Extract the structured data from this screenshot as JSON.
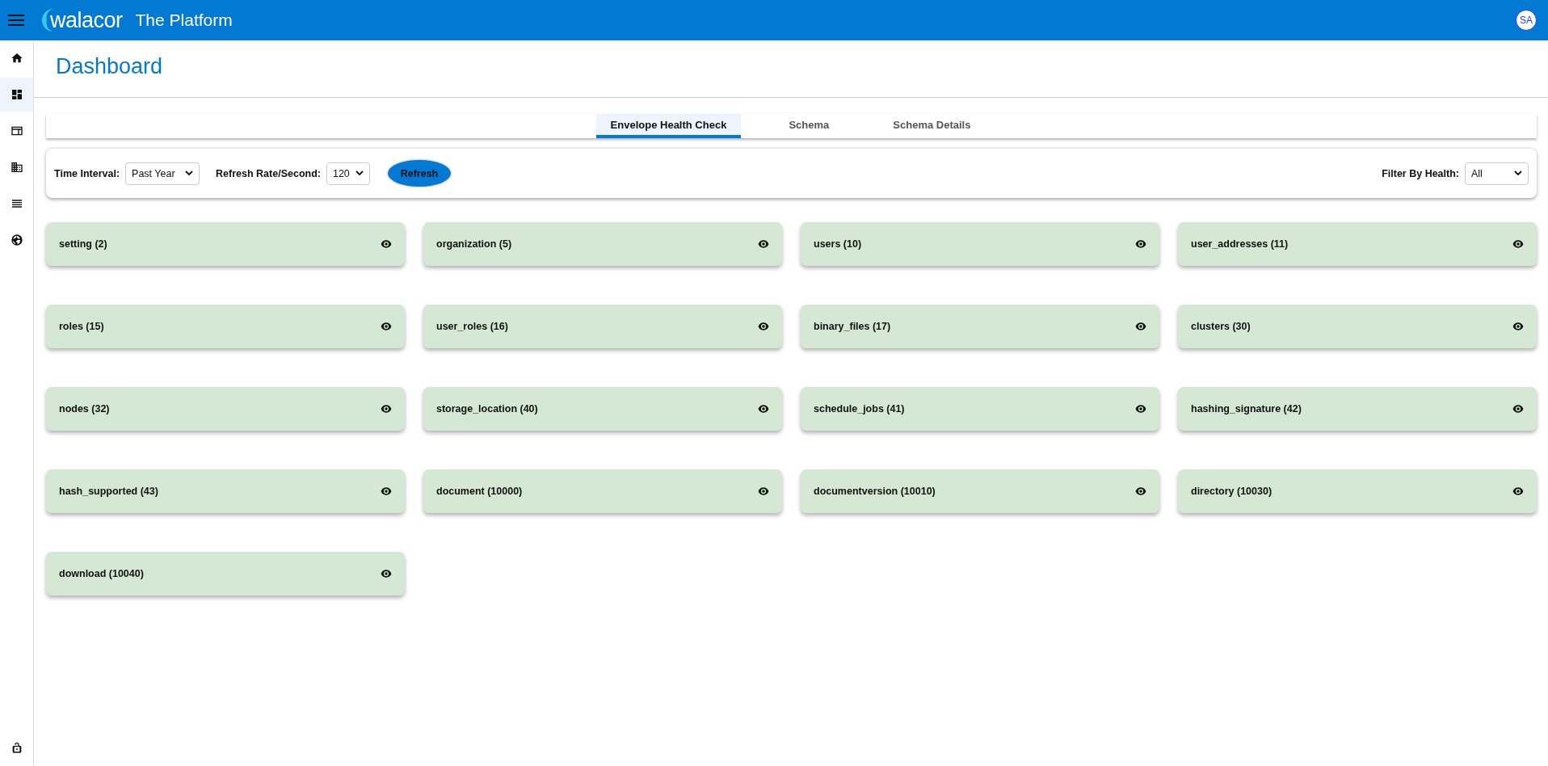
{
  "header": {
    "logo": "walacor",
    "title": "The Platform",
    "avatar": "SA"
  },
  "sidebar": {
    "items": [
      {
        "selected": false
      },
      {
        "selected": true
      },
      {
        "selected": false
      },
      {
        "selected": false
      },
      {
        "selected": false
      },
      {
        "selected": false
      }
    ]
  },
  "page": {
    "title": "Dashboard"
  },
  "tabs": [
    {
      "label": "Envelope Health Check",
      "selected": true
    },
    {
      "label": "Schema",
      "selected": false
    },
    {
      "label": "Schema Details",
      "selected": false
    }
  ],
  "filters": {
    "time_interval": {
      "label": "Time Interval:",
      "value": "Past Year"
    },
    "refresh_rate": {
      "label": "Refresh Rate/Second:",
      "value": "120"
    },
    "refresh_button": "Refresh",
    "filter_by_health": {
      "label": "Filter By Health:",
      "value": "All"
    }
  },
  "cards": [
    {
      "label": "setting (2)"
    },
    {
      "label": "organization (5)"
    },
    {
      "label": "users (10)"
    },
    {
      "label": "user_addresses (11)"
    },
    {
      "label": "roles (15)"
    },
    {
      "label": "user_roles (16)"
    },
    {
      "label": "binary_files (17)"
    },
    {
      "label": "clusters (30)"
    },
    {
      "label": "nodes (32)"
    },
    {
      "label": "storage_location (40)"
    },
    {
      "label": "schedule_jobs (41)"
    },
    {
      "label": "hashing_signature (42)"
    },
    {
      "label": "hash_supported (43)"
    },
    {
      "label": "document (10000)"
    },
    {
      "label": "documentversion (10010)"
    },
    {
      "label": "directory (10030)"
    },
    {
      "label": "download (10040)"
    }
  ]
}
